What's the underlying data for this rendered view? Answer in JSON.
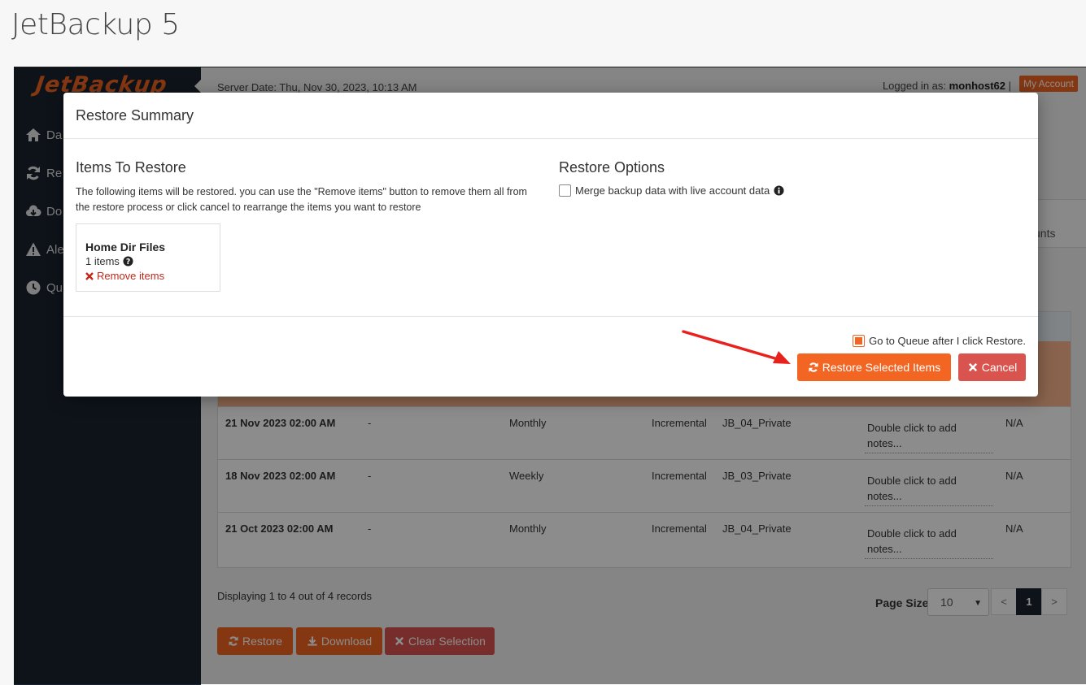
{
  "page_title": "JetBackup 5",
  "logo": "JetBackup",
  "sidebar": {
    "items": [
      {
        "label": "Da",
        "icon": "home-icon"
      },
      {
        "label": "Re",
        "icon": "refresh-icon"
      },
      {
        "label": "Do",
        "icon": "cloud-download-icon"
      },
      {
        "label": "Ale",
        "icon": "warning-icon"
      },
      {
        "label": "Qu",
        "icon": "clock-icon"
      }
    ]
  },
  "topbar": {
    "server_date": "Server Date: Thu, Nov 30, 2023, 10:13 AM",
    "logged_in_label": "Logged in as:",
    "username": "monhost62",
    "separator": "|",
    "my_account": "My Account"
  },
  "background_tab_peek": "unts",
  "table": {
    "rows": [
      {
        "date": "21 Nov 2023 02:00 AM",
        "dash": "-",
        "frequency": "Monthly",
        "type": "Incremental",
        "destination": "JB_04_Private",
        "notes": "Double click to add notes...",
        "value": "N/A"
      },
      {
        "date": "18 Nov 2023 02:00 AM",
        "dash": "-",
        "frequency": "Weekly",
        "type": "Incremental",
        "destination": "JB_03_Private",
        "notes": "Double click to add notes...",
        "value": "N/A"
      },
      {
        "date": "21 Oct 2023 02:00 AM",
        "dash": "-",
        "frequency": "Monthly",
        "type": "Incremental",
        "destination": "JB_04_Private",
        "notes": "Double click to add notes...",
        "value": "N/A"
      }
    ]
  },
  "footer": {
    "records": "Displaying 1 to 4 out of 4 records",
    "page_size_label": "Page Size",
    "page_size_value": "10",
    "pager": {
      "prev": "<",
      "current": "1",
      "next": ">"
    },
    "buttons": {
      "restore": "Restore",
      "download": "Download",
      "clear": "Clear Selection"
    }
  },
  "modal": {
    "title": "Restore Summary",
    "items_title": "Items To Restore",
    "description": "The following items will be restored. you can use the \"Remove items\" button to remove them all from the restore process or click cancel to rearrange the items you want to restore",
    "item": {
      "name": "Home Dir Files",
      "count": "1 items",
      "remove": "Remove items"
    },
    "options_title": "Restore Options",
    "merge_label": "Merge backup data with live account data",
    "merge_checked": false,
    "queue_label": "Go to Queue after I click Restore.",
    "queue_checked": true,
    "restore_button": "Restore Selected Items",
    "cancel_button": "Cancel"
  },
  "colors": {
    "accent": "#f26522",
    "danger": "#d9534f",
    "sidebar": "#1b2430",
    "annotation_arrow": "#e8211d"
  }
}
